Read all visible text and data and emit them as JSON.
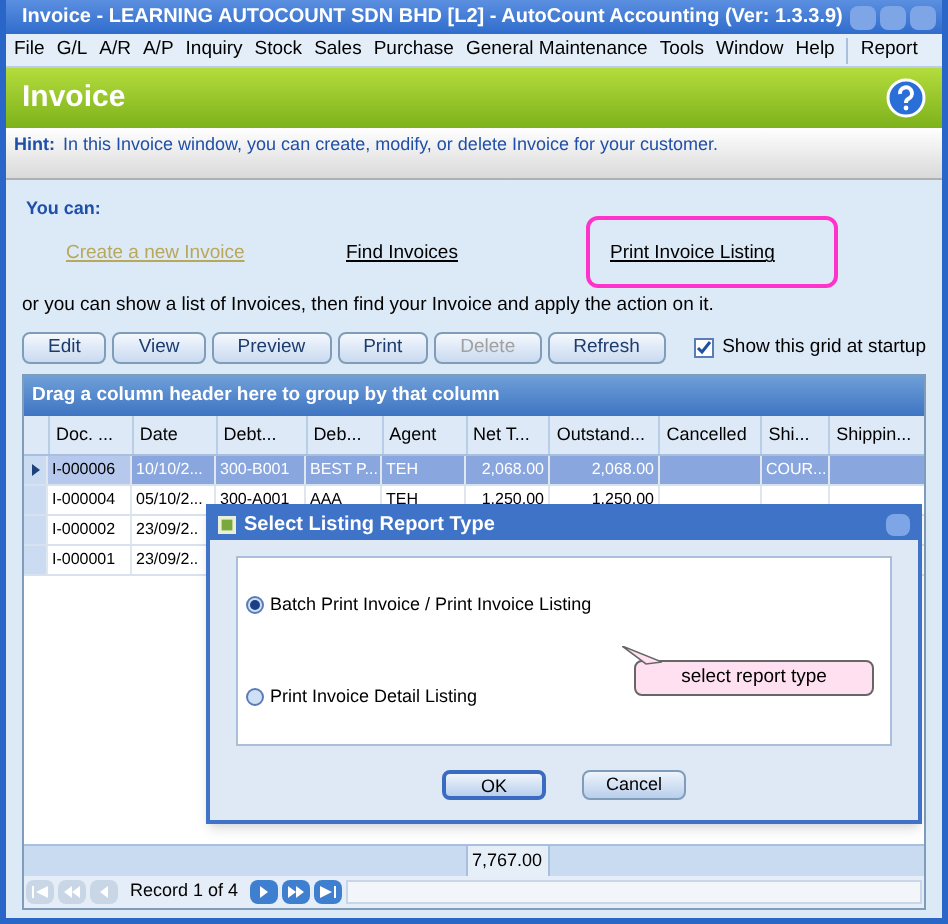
{
  "window": {
    "title": "Invoice - LEARNING AUTOCOUNT SDN BHD [L2] - AutoCount Accounting (Ver: 1.3.3.9)"
  },
  "menu": [
    "File",
    "G/L",
    "A/R",
    "A/P",
    "Inquiry",
    "Stock",
    "Sales",
    "Purchase",
    "General Maintenance",
    "Tools",
    "Window",
    "Help",
    "Report"
  ],
  "header": {
    "title": "Invoice"
  },
  "hint": {
    "label": "Hint:",
    "text": "In this Invoice window, you can create, modify, or delete Invoice for your customer."
  },
  "you_can": "You can:",
  "links": [
    {
      "label": "Create a new Invoice",
      "visited": true,
      "highlighted": false
    },
    {
      "label": "Find Invoices",
      "visited": false,
      "highlighted": false
    },
    {
      "label": "Print Invoice Listing",
      "visited": false,
      "highlighted": true
    }
  ],
  "or_text": "or you can show a list of Invoices, then find your Invoice and apply the action on it.",
  "toolbar": [
    {
      "label": "Edit",
      "disabled": false
    },
    {
      "label": "View",
      "disabled": false
    },
    {
      "label": "Preview",
      "disabled": false
    },
    {
      "label": "Print",
      "disabled": false
    },
    {
      "label": "Delete",
      "disabled": true
    },
    {
      "label": "Refresh",
      "disabled": false
    }
  ],
  "show_grid": {
    "label": "Show this grid at startup",
    "checked": true
  },
  "grid": {
    "group_text": "Drag a column header here to group by that column",
    "columns": [
      "Doc. ...",
      "Date",
      "Debt...",
      "Deb...",
      "Agent",
      "Net T...",
      "Outstand...",
      "Cancelled",
      "Shi...",
      "Shippin..."
    ],
    "rows": [
      {
        "selected": true,
        "cells": [
          "I-000006",
          "10/10/2...",
          "300-B001",
          "BEST P...",
          "TEH",
          "2,068.00",
          "2,068.00",
          "",
          "COUR...",
          ""
        ]
      },
      {
        "selected": false,
        "cells": [
          "I-000004",
          "05/10/2...",
          "300-A001",
          "AAA",
          "TEH",
          "1,250.00",
          "1,250.00",
          "",
          "",
          ""
        ]
      },
      {
        "selected": false,
        "cells": [
          "I-000002",
          "23/09/2..",
          "",
          "",
          "",
          "",
          "",
          "",
          "",
          ""
        ]
      },
      {
        "selected": false,
        "cells": [
          "I-000001",
          "23/09/2..",
          "",
          "",
          "",
          "",
          "",
          "",
          "",
          ""
        ]
      }
    ],
    "total": "7,767.00",
    "record": "Record 1 of 4"
  },
  "dialog": {
    "title": "Select Listing Report Type",
    "options": [
      {
        "label": "Batch Print Invoice / Print Invoice Listing",
        "selected": true
      },
      {
        "label": "Print Invoice Detail Listing",
        "selected": false
      }
    ],
    "callout": "select report type",
    "buttons": [
      "OK",
      "Cancel"
    ]
  }
}
